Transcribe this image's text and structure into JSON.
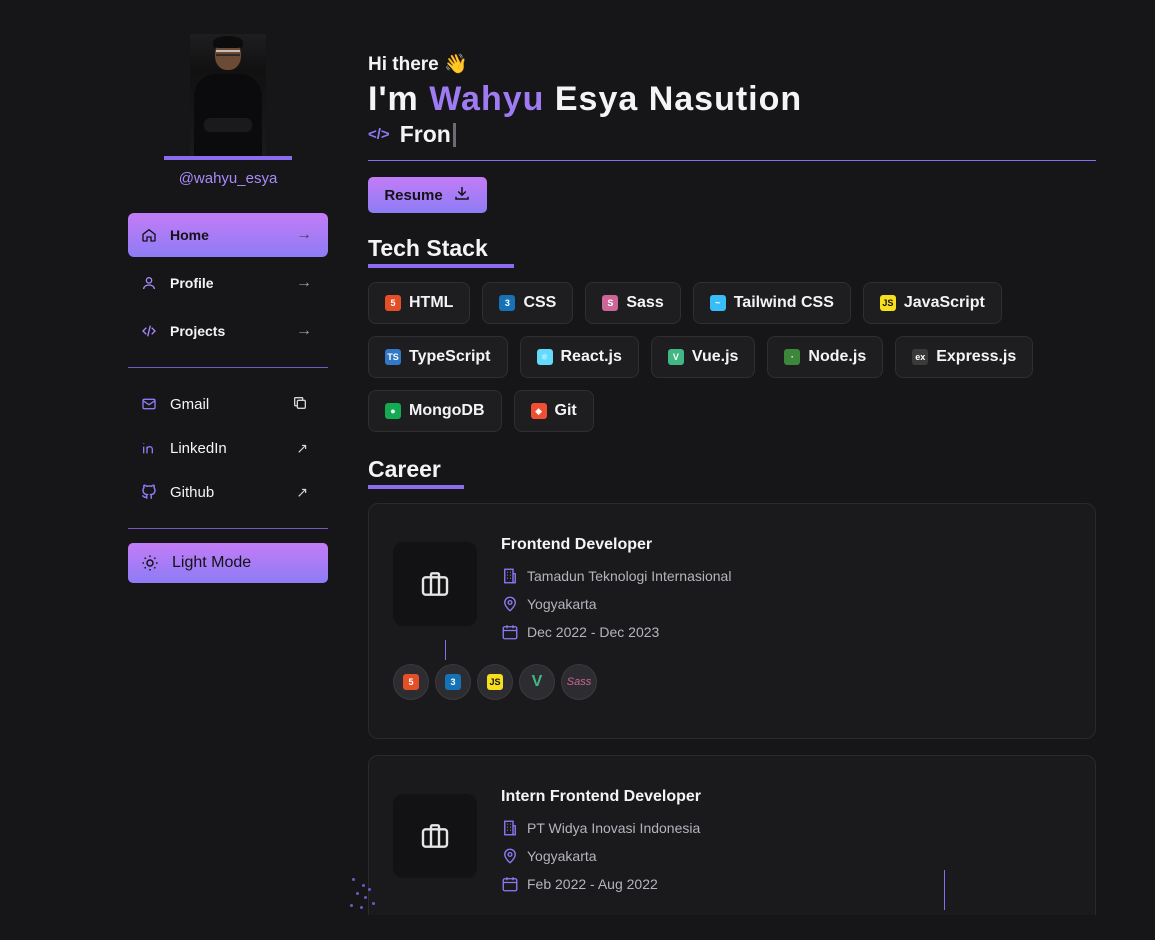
{
  "sidebar": {
    "username": "@wahyu_esya",
    "nav": [
      {
        "label": "Home",
        "icon": "home-icon"
      },
      {
        "label": "Profile",
        "icon": "user-icon"
      },
      {
        "label": "Projects",
        "icon": "code-icon"
      }
    ],
    "links": [
      {
        "label": "Gmail",
        "icon": "mail-icon",
        "action": "copy-icon"
      },
      {
        "label": "LinkedIn",
        "icon": "linkedin-icon",
        "action": "external-link-icon"
      },
      {
        "label": "Github",
        "icon": "github-icon",
        "action": "external-link-icon"
      }
    ],
    "mode_label": "Light Mode"
  },
  "hero": {
    "greeting": "Hi there",
    "wave": "👋",
    "name_prefix": "I'm ",
    "name_first": "Wahyu",
    "name_rest": " Esya Nasution",
    "code_glyph": "</>",
    "role_typed": "Fron",
    "resume_label": "Resume"
  },
  "tech_stack": {
    "title": "Tech Stack",
    "items": [
      {
        "label": "HTML",
        "badge": "5",
        "color": "#e34f26"
      },
      {
        "label": "CSS",
        "badge": "3",
        "color": "#1572b6"
      },
      {
        "label": "Sass",
        "badge": "S",
        "color": "#cc6699"
      },
      {
        "label": "Tailwind CSS",
        "badge": "~",
        "color": "#38bdf8"
      },
      {
        "label": "JavaScript",
        "badge": "JS",
        "color": "#f7df1e"
      },
      {
        "label": "TypeScript",
        "badge": "TS",
        "color": "#3178c6"
      },
      {
        "label": "React.js",
        "badge": "⚛",
        "color": "#61dafb"
      },
      {
        "label": "Vue.js",
        "badge": "V",
        "color": "#41b883"
      },
      {
        "label": "Node.js",
        "badge": "·",
        "color": "#3c873a"
      },
      {
        "label": "Express.js",
        "badge": "ex",
        "color": "#3a3a3a"
      },
      {
        "label": "MongoDB",
        "badge": "●",
        "color": "#13aa52"
      },
      {
        "label": "Git",
        "badge": "◆",
        "color": "#f05032"
      }
    ]
  },
  "career": {
    "title": "Career",
    "jobs": [
      {
        "title": "Frontend Developer",
        "company": "Tamadun Teknologi Internasional",
        "location": "Yogyakarta",
        "period": "Dec 2022 - Dec 2023",
        "skills": [
          "html5-icon",
          "css3-icon",
          "javascript-icon",
          "vue-icon",
          "sass-icon"
        ]
      },
      {
        "title": "Intern Frontend Developer",
        "company": "PT Widya Inovasi Indonesia",
        "location": "Yogyakarta",
        "period": "Feb 2022 - Aug 2022"
      }
    ]
  },
  "colors": {
    "accent": "#9f7bf2",
    "background": "#161517",
    "card": "#1a1a1c"
  }
}
